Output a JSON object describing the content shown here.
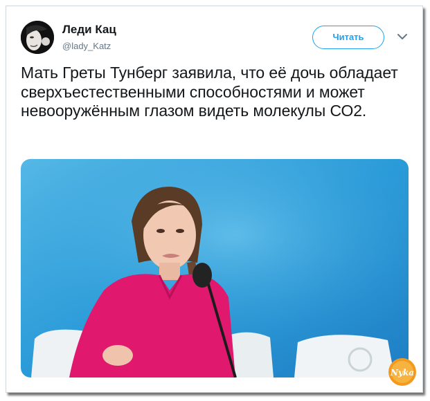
{
  "author": {
    "name": "Леди Кац",
    "handle": "@lady_Katz"
  },
  "follow_button": {
    "label": "Читать"
  },
  "tweet": {
    "text": "Мать Греты Тунберг заявила, что её дочь обладает сверхъестественными способностями и может невооружённым глазом видеть молекулы СО2."
  },
  "watermark": {
    "text": "Nyka"
  },
  "icons": {
    "menu": "chevron-down-icon"
  },
  "colors": {
    "accent": "#1da1f2",
    "text": "#14171a",
    "muted": "#657786",
    "photo_background": "#2a9ad8",
    "shirt": "#e0186e"
  }
}
